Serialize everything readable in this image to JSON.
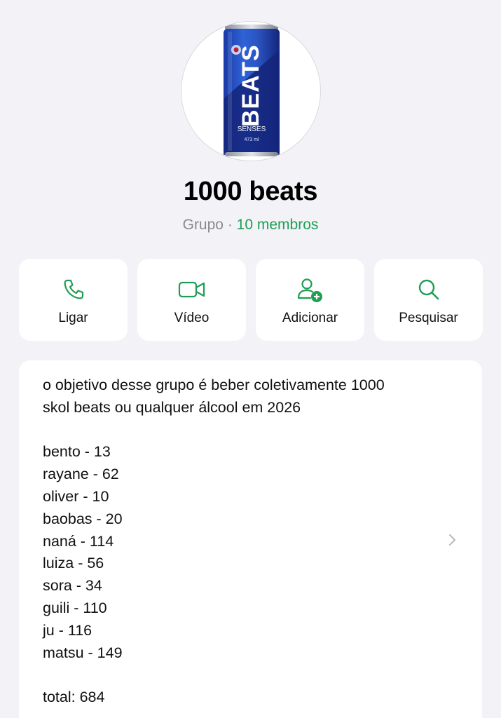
{
  "group": {
    "name": "1000 beats",
    "type_label": "Grupo",
    "separator": "·",
    "members_label": "10 membros",
    "avatar": {
      "icon": "beer-can-image",
      "can_brand": "BEATS",
      "can_subtitle": "SENSES",
      "can_volume": "473 ml",
      "colors": {
        "can_dark": "#14257a",
        "can_light": "#2f62d6"
      }
    }
  },
  "actions": [
    {
      "label": "Ligar",
      "icon": "phone-icon"
    },
    {
      "label": "Vídeo",
      "icon": "video-camera-icon"
    },
    {
      "label": "Adicionar",
      "icon": "add-person-icon"
    },
    {
      "label": "Pesquisar",
      "icon": "search-icon"
    }
  ],
  "description": {
    "intro_line1": "o objetivo desse grupo é beber coletivamente 1000",
    "intro_line2": "skol beats ou qualquer álcool em 2026",
    "entries": [
      "bento - 13",
      "rayane - 62",
      "oliver - 10",
      "baobas - 20",
      "naná - 114",
      "luiza - 56",
      "sora - 34",
      "guili - 110",
      "ju - 116",
      "matsu - 149"
    ],
    "total": "total: 684"
  },
  "colors": {
    "accent": "#1f9d55",
    "background": "#f2f2f7",
    "card": "#ffffff",
    "secondary_text": "#8a8a8e"
  }
}
